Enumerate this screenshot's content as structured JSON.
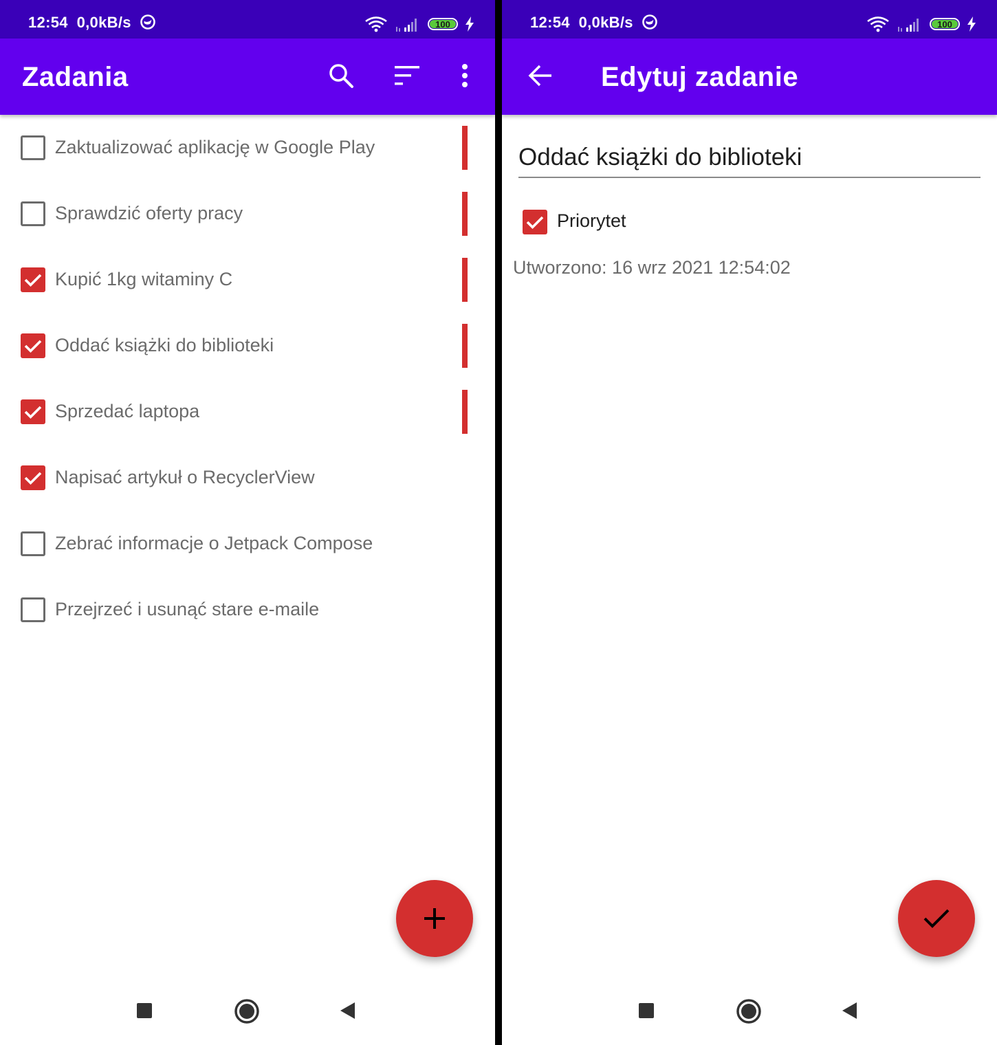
{
  "colors": {
    "statusbar": "#3a00b8",
    "toolbar": "#6200ee",
    "accent": "#d32f2f",
    "text_secondary": "#6b6b6b"
  },
  "status": {
    "time": "12:54",
    "speed": "0,0kB/s",
    "network": "LTE",
    "battery": "100"
  },
  "list_screen": {
    "title": "Zadania",
    "actions": [
      "search-icon",
      "sort-icon",
      "more-vert-icon"
    ],
    "tasks": [
      {
        "label": "Zaktualizować aplikację w Google Play",
        "completed": false,
        "priority": true
      },
      {
        "label": "Sprawdzić oferty pracy",
        "completed": false,
        "priority": true
      },
      {
        "label": "Kupić 1kg witaminy C",
        "completed": true,
        "priority": true
      },
      {
        "label": "Oddać książki do biblioteki",
        "completed": true,
        "priority": true
      },
      {
        "label": "Sprzedać laptopa",
        "completed": true,
        "priority": true
      },
      {
        "label": "Napisać artykuł o RecyclerView",
        "completed": true,
        "priority": false
      },
      {
        "label": "Zebrać informacje o Jetpack Compose",
        "completed": false,
        "priority": false
      },
      {
        "label": "Przejrzeć i usunąć stare e-maile",
        "completed": false,
        "priority": false
      }
    ],
    "fab_icon": "plus-icon"
  },
  "edit_screen": {
    "title": "Edytuj zadanie",
    "task_name": "Oddać książki do biblioteki",
    "priority_label": "Priorytet",
    "priority_checked": true,
    "created_label": "Utworzono: 16 wrz 2021 12:54:02",
    "fab_icon": "check-icon"
  }
}
